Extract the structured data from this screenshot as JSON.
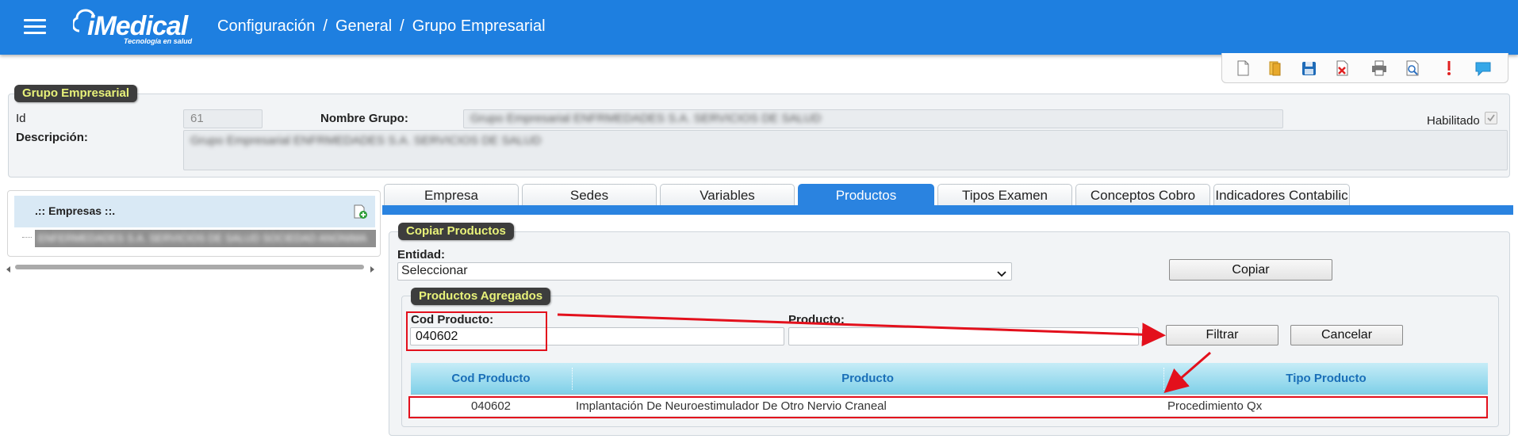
{
  "header": {
    "logo_text": "iMedical",
    "logo_tagline": "Tecnología en salud",
    "breadcrumb": [
      "Configuración",
      "General",
      "Grupo Empresarial"
    ],
    "separator": "/"
  },
  "toolbar": {
    "buttons": [
      "new-document-icon",
      "open-folder-icon",
      "save-icon",
      "delete-icon",
      "print-icon",
      "preview-icon",
      "alert-icon",
      "comment-icon"
    ]
  },
  "group": {
    "legend": "Grupo Empresarial",
    "id_label": "Id",
    "id_value": "61",
    "name_label": "Nombre Grupo:",
    "name_value": "Grupo Empresarial ENFRMEDADES S.A. SERVICIOS DE SALUD",
    "description_label": "Descripción:",
    "description_value": "Grupo Empresarial ENFRMEDADES S.A. SERVICIOS DE SALUD",
    "enabled_label": "Habilitado"
  },
  "companies": {
    "title": ".:: Empresas ::.",
    "items": [
      "ENFERMEDADES S.A. SERVICIOS DE SALUD SOCIEDAD ANONIMA"
    ]
  },
  "tabs": [
    "Empresa",
    "Sedes",
    "Variables",
    "Productos",
    "Tipos Examen",
    "Conceptos Cobro",
    "Indicadores Contabilic"
  ],
  "active_tab": "Productos",
  "copy_products": {
    "legend": "Copiar Productos",
    "entity_label": "Entidad:",
    "entity_selected": "Seleccionar",
    "copy_button": "Copiar"
  },
  "added_products": {
    "legend": "Productos Agregados",
    "code_label": "Cod Producto:",
    "code_value": "040602",
    "product_label": "Producto:",
    "product_value": "",
    "filter_button": "Filtrar",
    "cancel_button": "Cancelar",
    "columns": [
      "Cod Producto",
      "Producto",
      "Tipo Producto"
    ],
    "rows": [
      {
        "code": "040602",
        "product": "Implantación De Neuroestimulador De Otro Nervio Craneal",
        "type": "Procedimiento Qx"
      }
    ]
  },
  "colors": {
    "header_blue": "#1e7fe0",
    "tab_active": "#2a83e0",
    "legend_bg": "#3d3d3d",
    "legend_text": "#e8f27a",
    "annotation_red": "#e3101c"
  }
}
